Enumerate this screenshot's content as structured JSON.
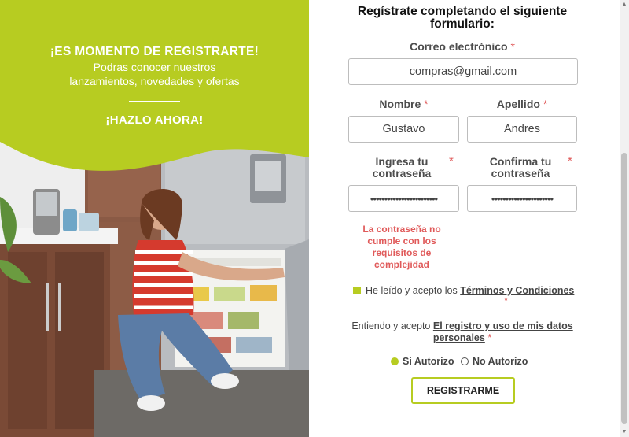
{
  "promo": {
    "heading": "¡ES MOMENTO DE REGISTRARTE!",
    "subtitle_line1": "Podras conocer nuestros",
    "subtitle_line2": "lanzamientos, novedades y ofertas",
    "cta": "¡HAZLO AHORA!",
    "accent_color": "#b7cc21"
  },
  "form": {
    "title_line1": "Regístrate completando el siguiente",
    "title_line2": "formulario:",
    "email": {
      "label": "Correo electrónico",
      "required_mark": "*",
      "value": "compras@gmail.com"
    },
    "first_name": {
      "label": "Nombre",
      "required_mark": "*",
      "value": "Gustavo"
    },
    "last_name": {
      "label": "Apellido",
      "required_mark": "*",
      "value": "Andres"
    },
    "password": {
      "label_line1": "Ingresa tu",
      "label_line2": "contraseña",
      "required_mark": "*",
      "value": "••••••••••••••••••••••••"
    },
    "confirm_password": {
      "label_line1": "Confirma tu",
      "label_line2": "contraseña",
      "required_mark": "*",
      "value": "••••••••••••••••••••••"
    },
    "password_error": "La contraseña no cumple con los requisitos de complejidad",
    "terms": {
      "prefix": "He leído y acepto los ",
      "link": "Términos y Condiciones",
      "required_mark": "*",
      "checked": true
    },
    "consent": {
      "prefix": "Entiendo y acepto ",
      "link": "El registro y uso de mis datos personales",
      "required_mark": "*"
    },
    "authorize": {
      "yes_label": "Si Autorizo",
      "no_label": "No Autorizo",
      "selected": "yes"
    },
    "submit_label": "REGISTRARME"
  },
  "colors": {
    "accent": "#b7cc21",
    "required": "#e05a5a",
    "error": "#e05a5a",
    "text": "#444444"
  }
}
